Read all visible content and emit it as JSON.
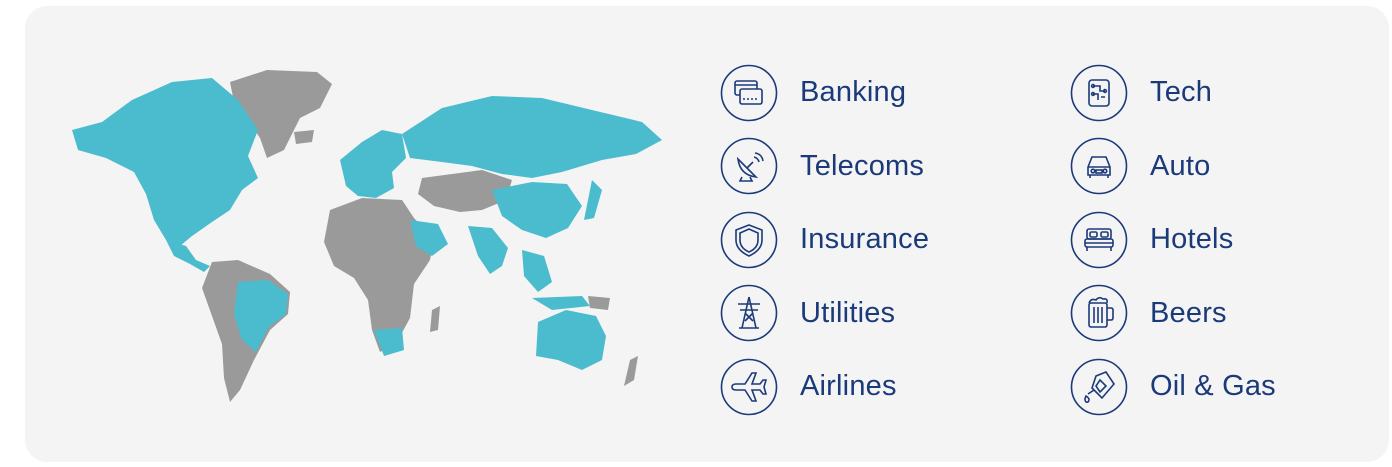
{
  "map": {
    "highlight_color": "#4bbccd",
    "base_color": "#9a9a9a"
  },
  "sectors": [
    {
      "label": "Banking",
      "icon": "credit-card-icon"
    },
    {
      "label": "Tech",
      "icon": "circuit-icon"
    },
    {
      "label": "Telecoms",
      "icon": "satellite-dish-icon"
    },
    {
      "label": "Auto",
      "icon": "car-icon"
    },
    {
      "label": "Insurance",
      "icon": "shield-icon"
    },
    {
      "label": "Hotels",
      "icon": "bed-icon"
    },
    {
      "label": "Utilities",
      "icon": "power-pylon-icon"
    },
    {
      "label": "Beers",
      "icon": "beer-mug-icon"
    },
    {
      "label": "Airlines",
      "icon": "airplane-icon"
    },
    {
      "label": "Oil & Gas",
      "icon": "oil-can-icon"
    }
  ],
  "colors": {
    "text": "#1b3a7a",
    "icon_stroke": "#1b3a7a",
    "panel": "#f4f4f4"
  }
}
